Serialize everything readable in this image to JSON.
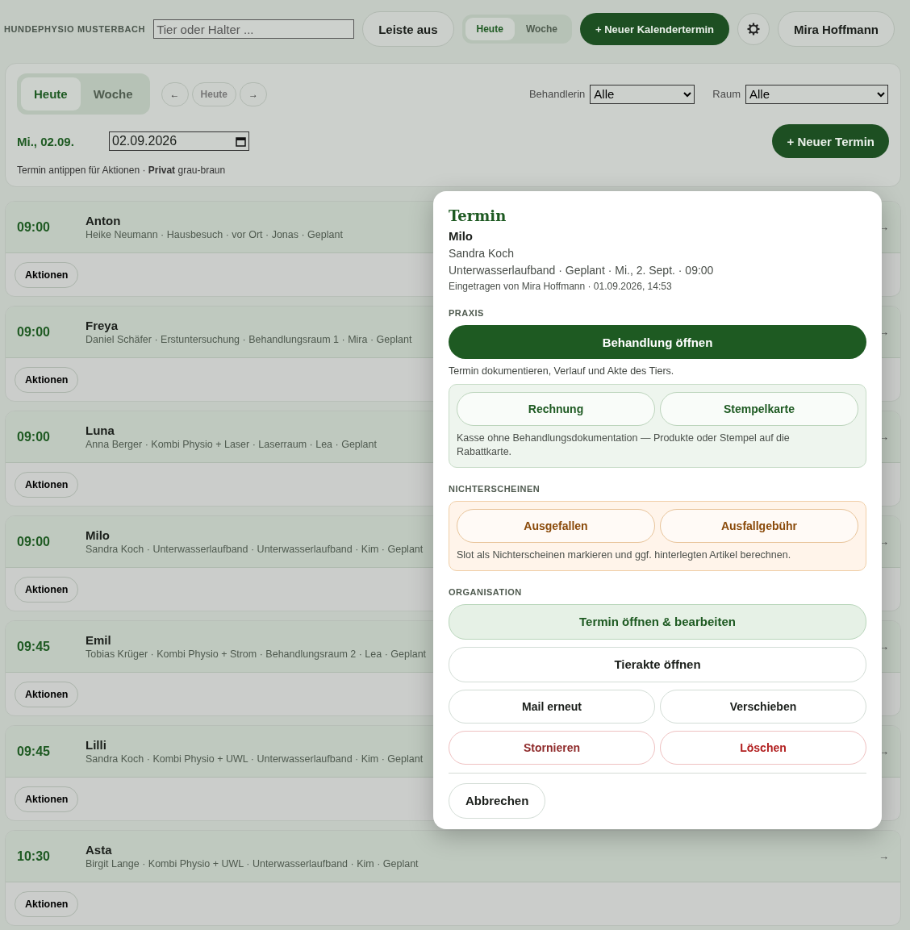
{
  "topbar": {
    "brand": "HUNDEPHYSIO MUSTERBACH",
    "search": {
      "placeholder": "Tier oder Halter ..."
    },
    "toggle_button": "Leiste aus",
    "view_tabs": [
      {
        "label": "Heute",
        "selected": true
      },
      {
        "label": "Woche",
        "selected": false
      }
    ],
    "new_button": "+ Neuer Kalendertermin",
    "user": "Mira Hoffmann"
  },
  "panel": {
    "view_tabs": [
      {
        "label": "Heute",
        "selected": true
      },
      {
        "label": "Woche",
        "selected": false
      }
    ],
    "nav": [
      {
        "label": "←",
        "kind": "arrow"
      },
      {
        "label": "Heute",
        "kind": "today"
      },
      {
        "label": "→",
        "kind": "arrow"
      }
    ],
    "filters": [
      {
        "label": "Behandlerin",
        "value": "Alle"
      },
      {
        "label": "Raum",
        "value": "Alle"
      }
    ],
    "date_label": "Mi., 02.09.",
    "date_value": "02.09.2026",
    "new_button": "+ Neuer Termin",
    "hint": "Termin antippen für Aktionen · **Privat** grau-braun"
  },
  "appointments": [
    {
      "time": "09:00",
      "animal": "Anton",
      "details": "Heike Neumann · Hausbesuch · vor Ort · Jonas · Geplant",
      "arrow": "→",
      "action": "Aktionen"
    },
    {
      "time": "09:00",
      "animal": "Freya",
      "details": "Daniel Schäfer · Erstuntersuchung · Behandlungsraum 1 · Mira · Geplant",
      "arrow": "→",
      "action": "Aktionen"
    },
    {
      "time": "09:00",
      "animal": "Luna",
      "details": "Anna Berger · Kombi Physio + Laser · Laserraum · Lea · Geplant",
      "arrow": "→",
      "action": "Aktionen"
    },
    {
      "time": "09:00",
      "animal": "Milo",
      "details": "Sandra Koch · Unterwasserlaufband · Unterwasserlaufband · Kim · Geplant",
      "arrow": "→",
      "action": "Aktionen"
    },
    {
      "time": "09:45",
      "animal": "Emil",
      "details": "Tobias Krüger · Kombi Physio + Strom · Behandlungsraum 2 · Lea · Geplant",
      "arrow": "→",
      "action": "Aktionen"
    },
    {
      "time": "09:45",
      "animal": "Lilli",
      "details": "Sandra Koch · Kombi Physio + UWL · Unterwasserlaufband · Kim · Geplant",
      "arrow": "→",
      "action": "Aktionen"
    },
    {
      "time": "10:30",
      "animal": "Asta",
      "details": "Birgit Lange · Kombi Physio + UWL · Unterwasserlaufband · Kim · Geplant",
      "arrow": "→",
      "action": "Aktionen"
    }
  ],
  "popup": {
    "title": "Termin",
    "animal": "Milo",
    "owner": "Sandra Koch",
    "summary": "Unterwasserlaufband · Geplant · Mi., 2. Sept. · 09:00",
    "entered": "Eingetragen von Mira Hoffmann · 01.09.2026, 14:53",
    "sections": [
      {
        "heading": "PRAXIS",
        "primary": "Behandlung öffnen",
        "primary_note": "Termin dokumentieren, Verlauf und Akte des Tiers.",
        "box": {
          "kind": "accent",
          "buttons": [
            "Rechnung",
            "Stempelkarte"
          ],
          "note": "Kasse ohne Behandlungsdokumentation — Produkte oder Stempel auf die Rabattkarte."
        }
      },
      {
        "heading": "NICHTERSCHEINEN",
        "box": {
          "kind": "warning",
          "buttons": [
            "Ausgefallen",
            "Ausfallgebühr"
          ],
          "note": "Slot als Nichterscheinen markieren und ggf. hinterlegten Artikel berechnen."
        }
      },
      {
        "heading": "ORGANISATION",
        "rows": [
          [
            {
              "label": "Termin öffnen & bearbeiten",
              "kind": "highlight"
            }
          ],
          [
            {
              "label": "Tierakte öffnen",
              "kind": "plain-large"
            }
          ],
          [
            {
              "label": "Mail erneut",
              "kind": "plain"
            },
            {
              "label": "Verschieben",
              "kind": "plain"
            }
          ],
          [
            {
              "label": "Stornieren",
              "kind": "danger"
            },
            {
              "label": "Löschen",
              "kind": "danger-strong"
            }
          ]
        ]
      }
    ],
    "cancel": "Abbrechen"
  }
}
